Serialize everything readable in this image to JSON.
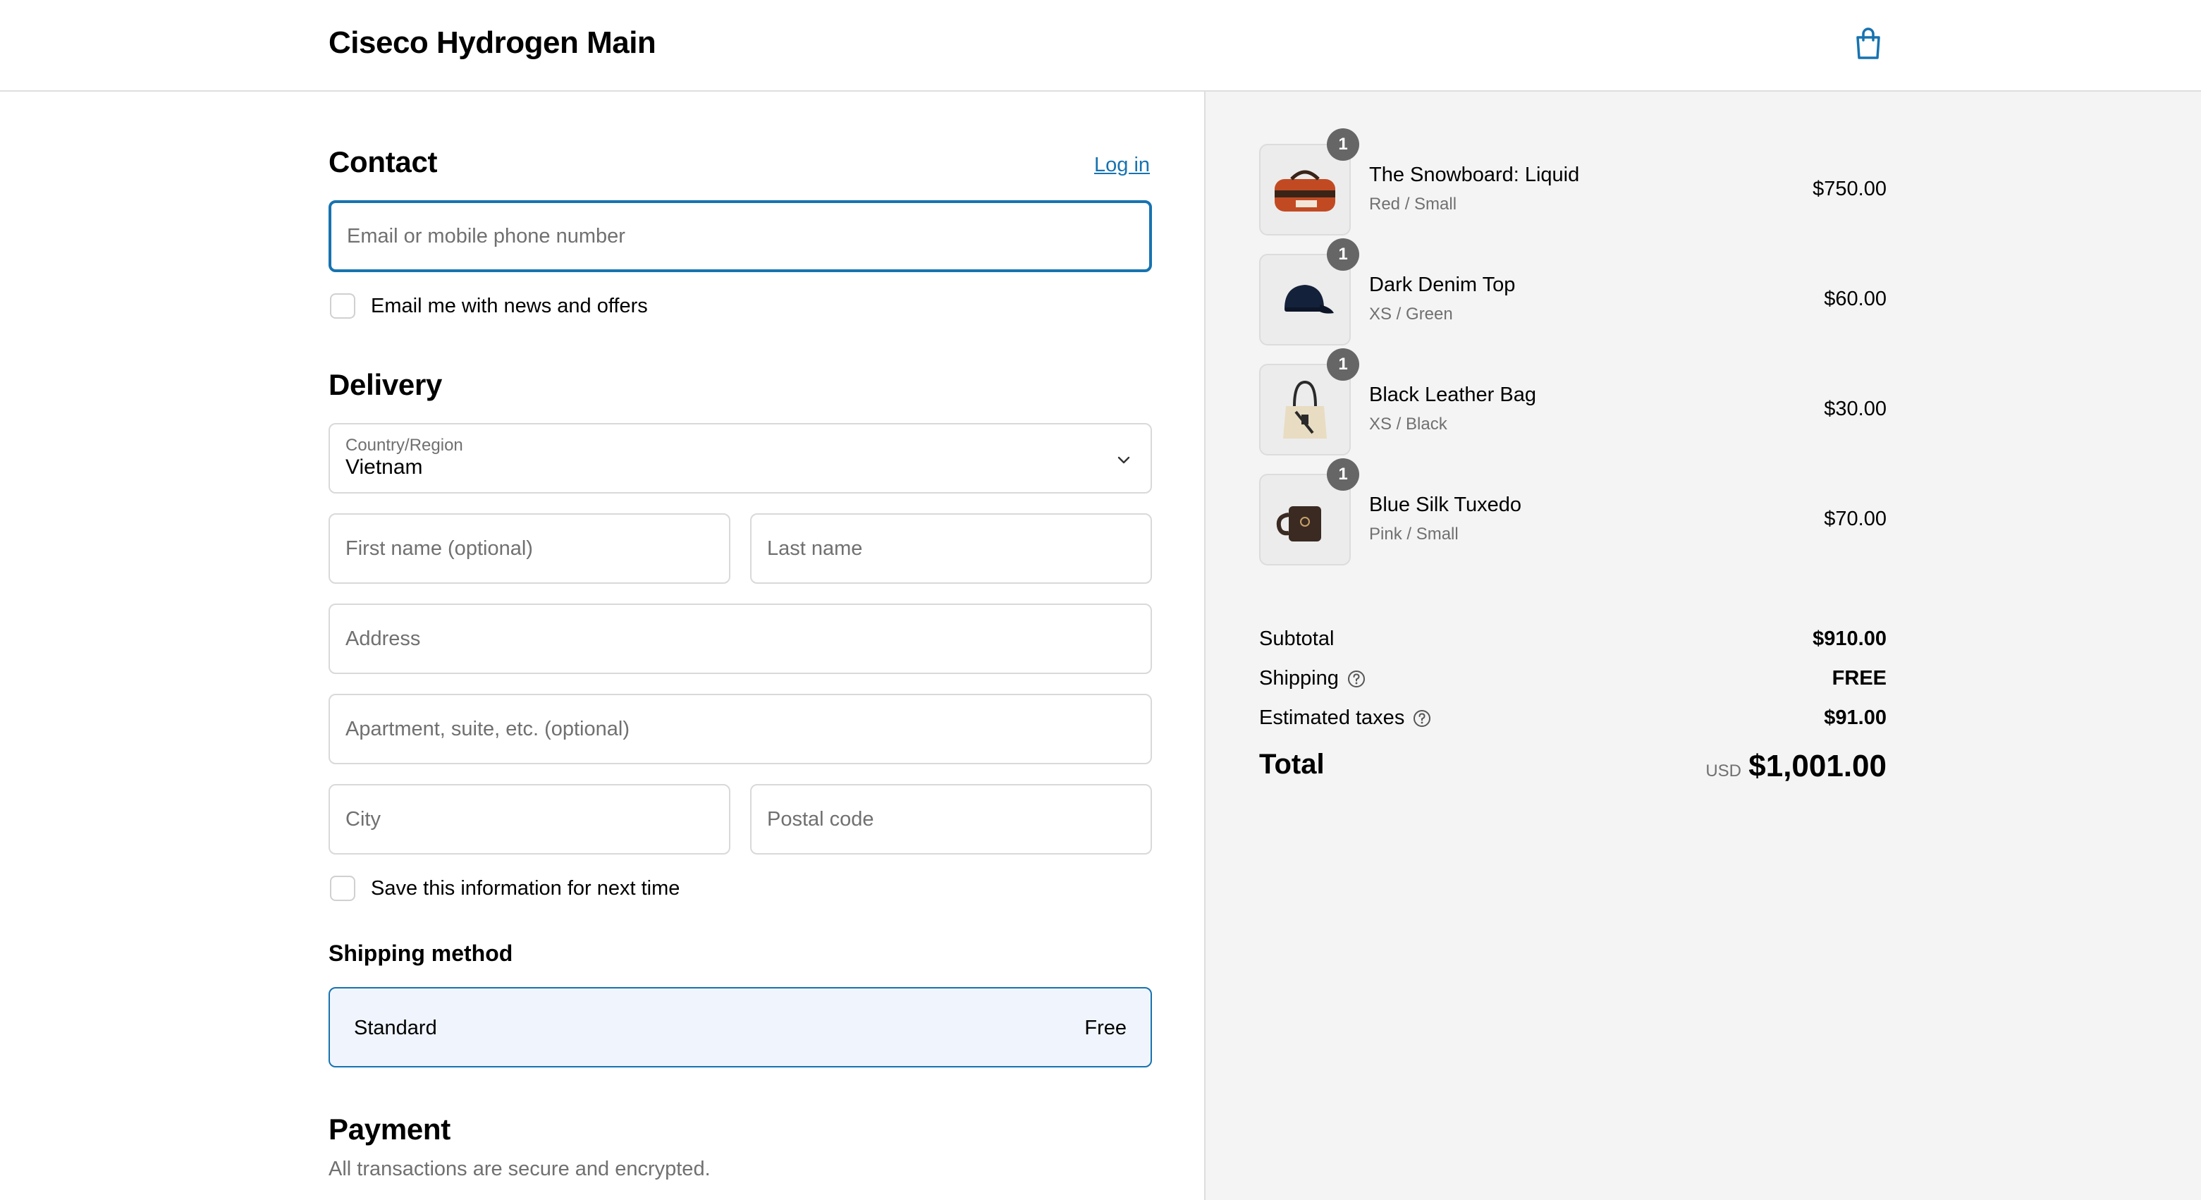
{
  "header": {
    "shop_title": "Ciseco Hydrogen Main",
    "cart_icon": "shopping-bag-icon"
  },
  "contact": {
    "heading": "Contact",
    "login_label": "Log in",
    "email_placeholder": "Email or mobile phone number",
    "news_label": "Email me with news and offers"
  },
  "delivery": {
    "heading": "Delivery",
    "country_label": "Country/Region",
    "country_value": "Vietnam",
    "first_name_placeholder": "First name (optional)",
    "last_name_placeholder": "Last name",
    "address_placeholder": "Address",
    "apartment_placeholder": "Apartment, suite, etc. (optional)",
    "city_placeholder": "City",
    "postal_placeholder": "Postal code",
    "save_label": "Save this information for next time"
  },
  "shipping_method": {
    "heading": "Shipping method",
    "option_name": "Standard",
    "option_price": "Free"
  },
  "payment": {
    "heading": "Payment",
    "subtitle": "All transactions are secure and encrypted."
  },
  "order": {
    "items": [
      {
        "name": "The Snowboard: Liquid",
        "variant": "Red / Small",
        "price": "$750.00",
        "qty": "1",
        "image": "duffel-bag-image"
      },
      {
        "name": "Dark Denim Top",
        "variant": "XS / Green",
        "price": "$60.00",
        "qty": "1",
        "image": "cap-image"
      },
      {
        "name": "Black Leather Bag",
        "variant": "XS / Black",
        "price": "$30.00",
        "qty": "1",
        "image": "tote-bag-image"
      },
      {
        "name": "Blue Silk Tuxedo",
        "variant": "Pink / Small",
        "price": "$70.00",
        "qty": "1",
        "image": "mug-image"
      }
    ],
    "subtotal_label": "Subtotal",
    "subtotal_value": "$910.00",
    "shipping_label": "Shipping",
    "shipping_value": "FREE",
    "taxes_label": "Estimated taxes",
    "taxes_value": "$91.00",
    "total_label": "Total",
    "total_currency": "USD",
    "total_value": "$1,001.00"
  },
  "colors": {
    "accent": "#1773b0",
    "selected_bg": "#f0f5fd",
    "summary_bg": "#f4f4f4",
    "badge": "#666666"
  }
}
